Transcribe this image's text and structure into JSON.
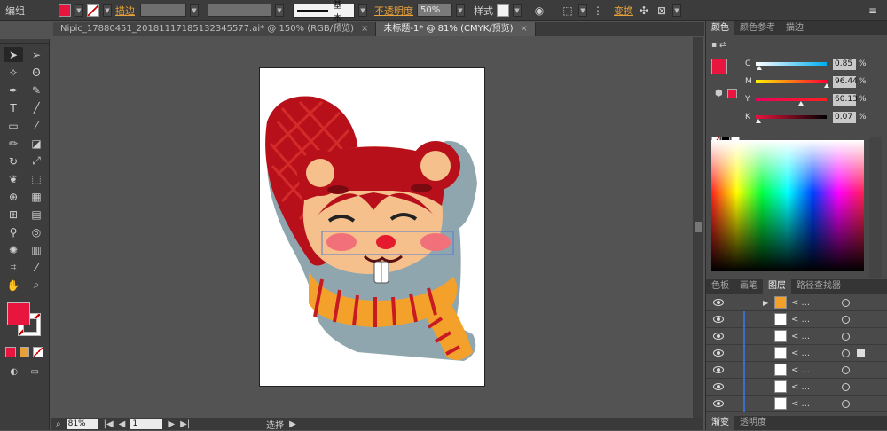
{
  "control_bar": {
    "selection_label": "编组",
    "fill_color": "#e8153f",
    "stroke_label": "描边",
    "brush_label": "基本",
    "opacity_label": "不透明度",
    "opacity_value": "50%",
    "style_label": "样式",
    "transform_label": "变换"
  },
  "tabs": [
    {
      "label": "Nipic_17880451_20181117185132345577.ai* @ 150% (RGB/预览)",
      "close": "×"
    },
    {
      "label": "未标题-1* @ 81% (CMYK/预览)",
      "close": "×"
    }
  ],
  "status_bar": {
    "zoom": "81%",
    "page": "1",
    "tool_status": "选择"
  },
  "color_panel": {
    "tabs": [
      "颜色",
      "颜色参考",
      "描边"
    ],
    "channels": [
      {
        "name": "C",
        "value": "0.85",
        "unit": "%",
        "level": 0.01,
        "gradient": "linear-gradient(to right,#ffffff,#00aeef)"
      },
      {
        "name": "M",
        "value": "96.44",
        "unit": "%",
        "level": 0.96,
        "gradient": "linear-gradient(to right,#fff200,#ff0030)"
      },
      {
        "name": "Y",
        "value": "60.13",
        "unit": "%",
        "level": 0.6,
        "gradient": "linear-gradient(to right,#e8005a,#ff2020)"
      },
      {
        "name": "K",
        "value": "0.07",
        "unit": "%",
        "level": 0.0,
        "gradient": "linear-gradient(to right,#e8153f,#000000)"
      }
    ],
    "current_fill": "#e8153f"
  },
  "layers_panel": {
    "tabs": [
      "色板",
      "画笔",
      "图层",
      "路径查找器"
    ],
    "rows": [
      {
        "name": "< ..."
      },
      {
        "name": "< ..."
      },
      {
        "name": "< ..."
      },
      {
        "name": "< ..."
      },
      {
        "name": "< ..."
      },
      {
        "name": "< ..."
      },
      {
        "name": "< ..."
      }
    ],
    "bottom_tabs": [
      "渐变",
      "透明度"
    ]
  }
}
